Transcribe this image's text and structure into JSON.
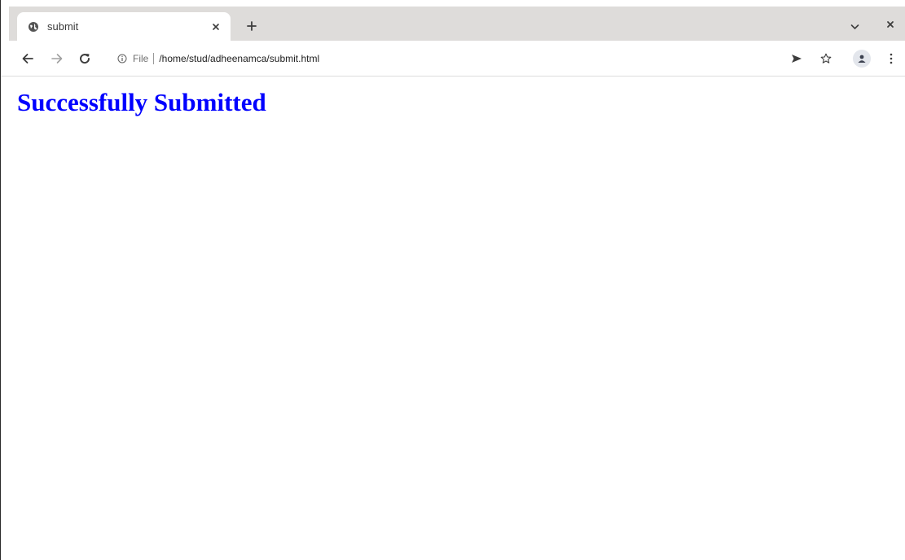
{
  "tab": {
    "title": "submit",
    "favicon": "globe-icon"
  },
  "toolbar": {
    "back_icon": "arrow-left-icon",
    "forward_icon": "arrow-right-icon",
    "reload_icon": "reload-icon"
  },
  "omnibox": {
    "scheme_label": "File",
    "url": "/home/stud/adheenamca/submit.html",
    "info_icon": "info-icon"
  },
  "actions": {
    "send_icon": "send-icon",
    "bookmark_icon": "star-icon",
    "profile_icon": "profile-icon",
    "menu_icon": "kebab-menu-icon"
  },
  "page": {
    "heading": "Successfully Submitted",
    "heading_color": "#0000ff"
  }
}
